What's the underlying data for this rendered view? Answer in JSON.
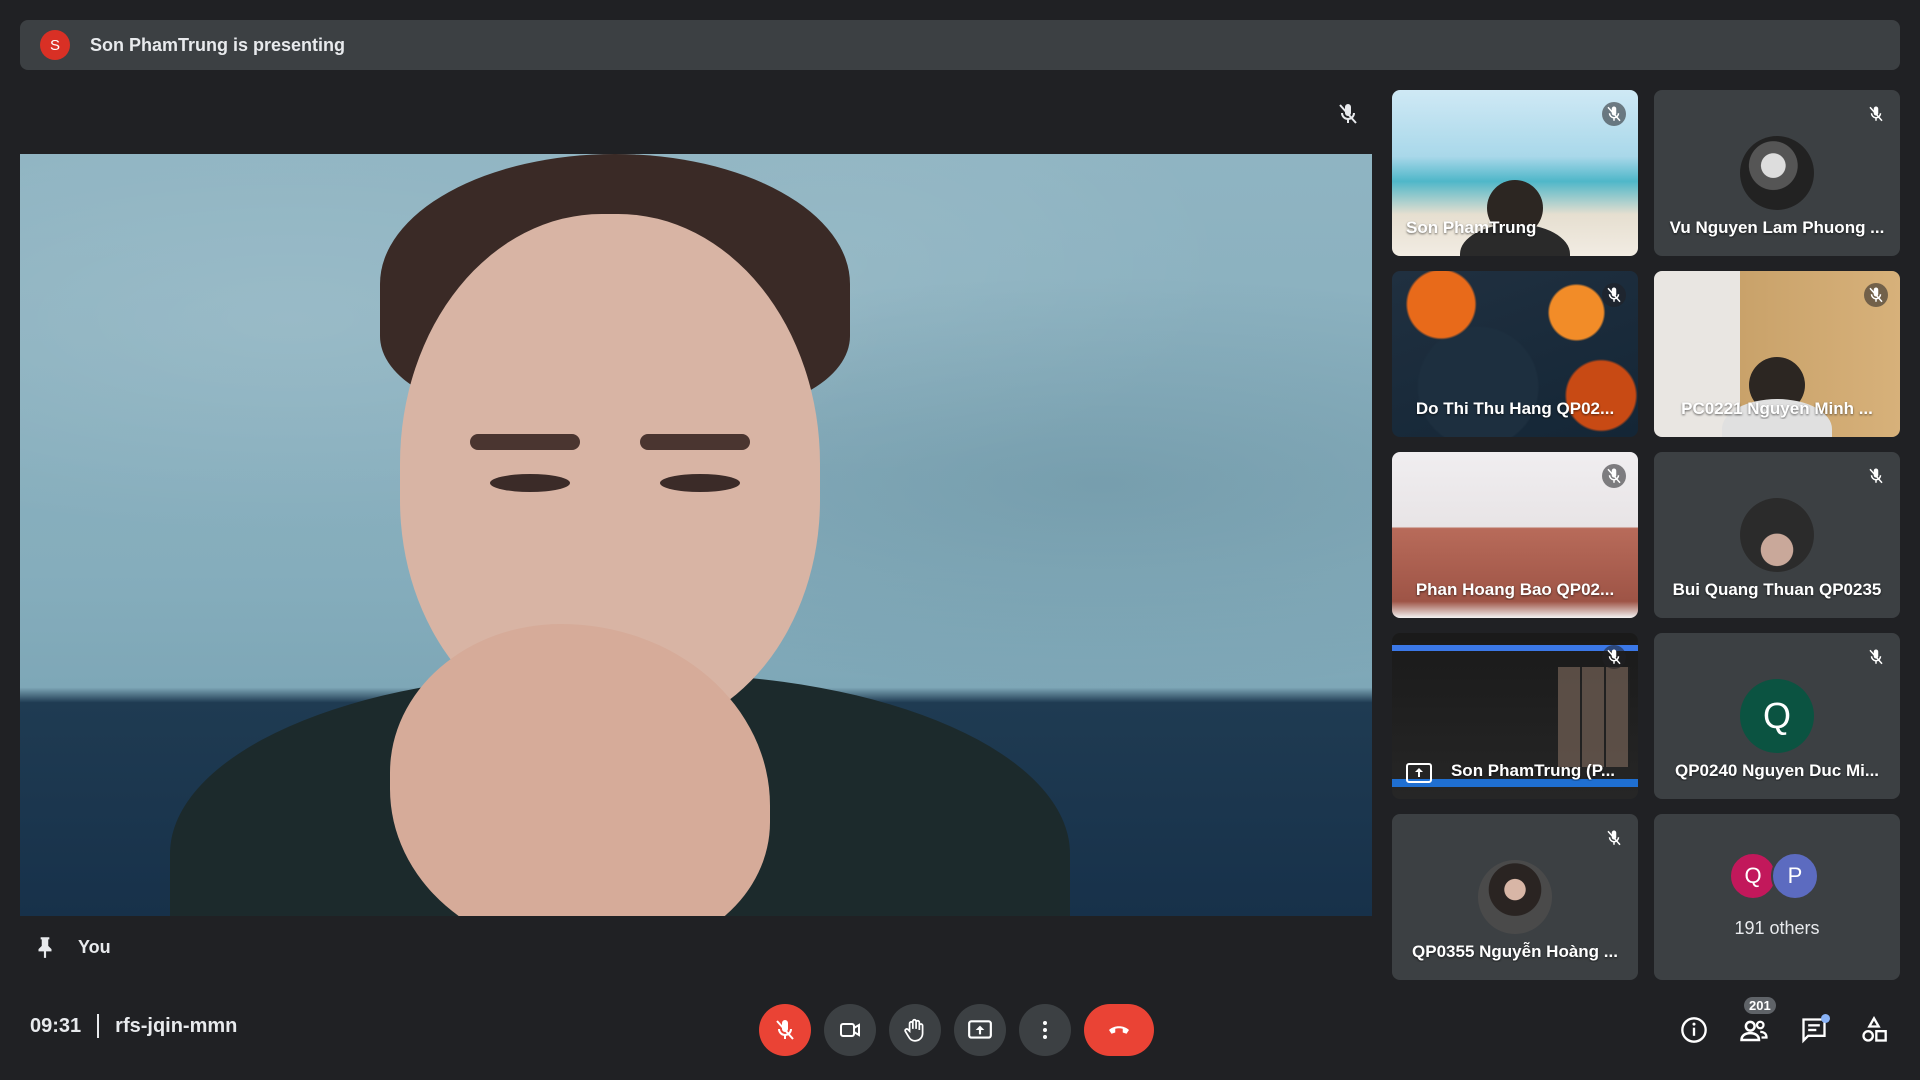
{
  "banner": {
    "avatar_letter": "S",
    "text": "Son PhamTrung is presenting"
  },
  "stage": {
    "label": "You"
  },
  "tiles": [
    {
      "name": "Son PhamTrung"
    },
    {
      "name": "Vu Nguyen Lam Phuong ..."
    },
    {
      "name": "Do Thi Thu Hang QP02..."
    },
    {
      "name": "PC0221 Nguyen Minh ..."
    },
    {
      "name": "Phan Hoang Bao QP02..."
    },
    {
      "name": "Bui Quang Thuan QP0235"
    },
    {
      "name": "Son PhamTrung (P..."
    },
    {
      "name": "QP0240 Nguyen Duc Mi...",
      "letter": "Q"
    },
    {
      "name": "QP0355 Nguyễn Hoàng ..."
    },
    {
      "name": "191 others",
      "letters": [
        "Q",
        "P"
      ]
    }
  ],
  "meeting": {
    "time": "09:31",
    "code": "rfs-jqin-mmn"
  },
  "people_count": "201",
  "colors": {
    "end_call": "#ea4335",
    "background": "#202124",
    "tile": "#3c4043"
  }
}
